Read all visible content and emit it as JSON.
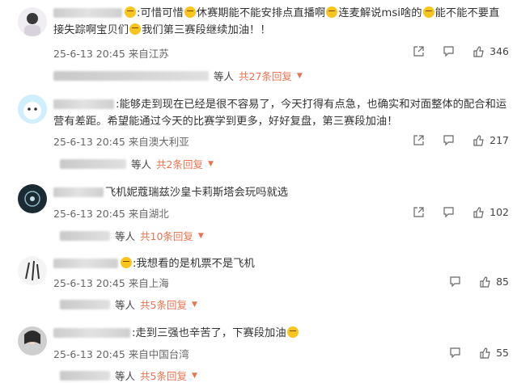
{
  "comments": [
    {
      "text_parts": [
        ":可惜可惜",
        "休赛期能不能安排点直播啊",
        "连麦解说msi啥的",
        "能不能不要直接失踪啊宝贝们",
        "我们第三赛段继续加油！！"
      ],
      "meta": "25-6-13 20:45 来自江苏",
      "likes": "346",
      "reply_prefix": "等人",
      "reply_count": "共27条回复"
    },
    {
      "text": ":能够走到现在已经是很不容易了，今天打得有点急，也确实和对面整体的配合和运营有差距。希望能通过今天的比赛学到更多，好好复盘，第三赛段加油！",
      "meta": "25-6-13 20:45 来自澳大利亚",
      "likes": "217",
      "reply_prefix": "等人",
      "reply_count": "共2条回复"
    },
    {
      "text": "飞机妮蔻瑞兹沙皇卡莉斯塔会玩吗就选",
      "meta": "25-6-13 20:45 来自湖北",
      "likes": "102",
      "reply_prefix": "等人",
      "reply_count": "共10条回复"
    },
    {
      "text": ":我想看的是机票不是飞机",
      "meta": "25-6-13 20:45 来自上海",
      "likes": "85",
      "reply_prefix": "等人",
      "reply_count": "共5条回复"
    },
    {
      "text": ":走到三强也辛苦了，下赛段加油",
      "meta": "25-6-13 20:45 来自中国台湾",
      "likes": "55",
      "reply_prefix": "等人",
      "reply_count": "共5条回复"
    }
  ]
}
